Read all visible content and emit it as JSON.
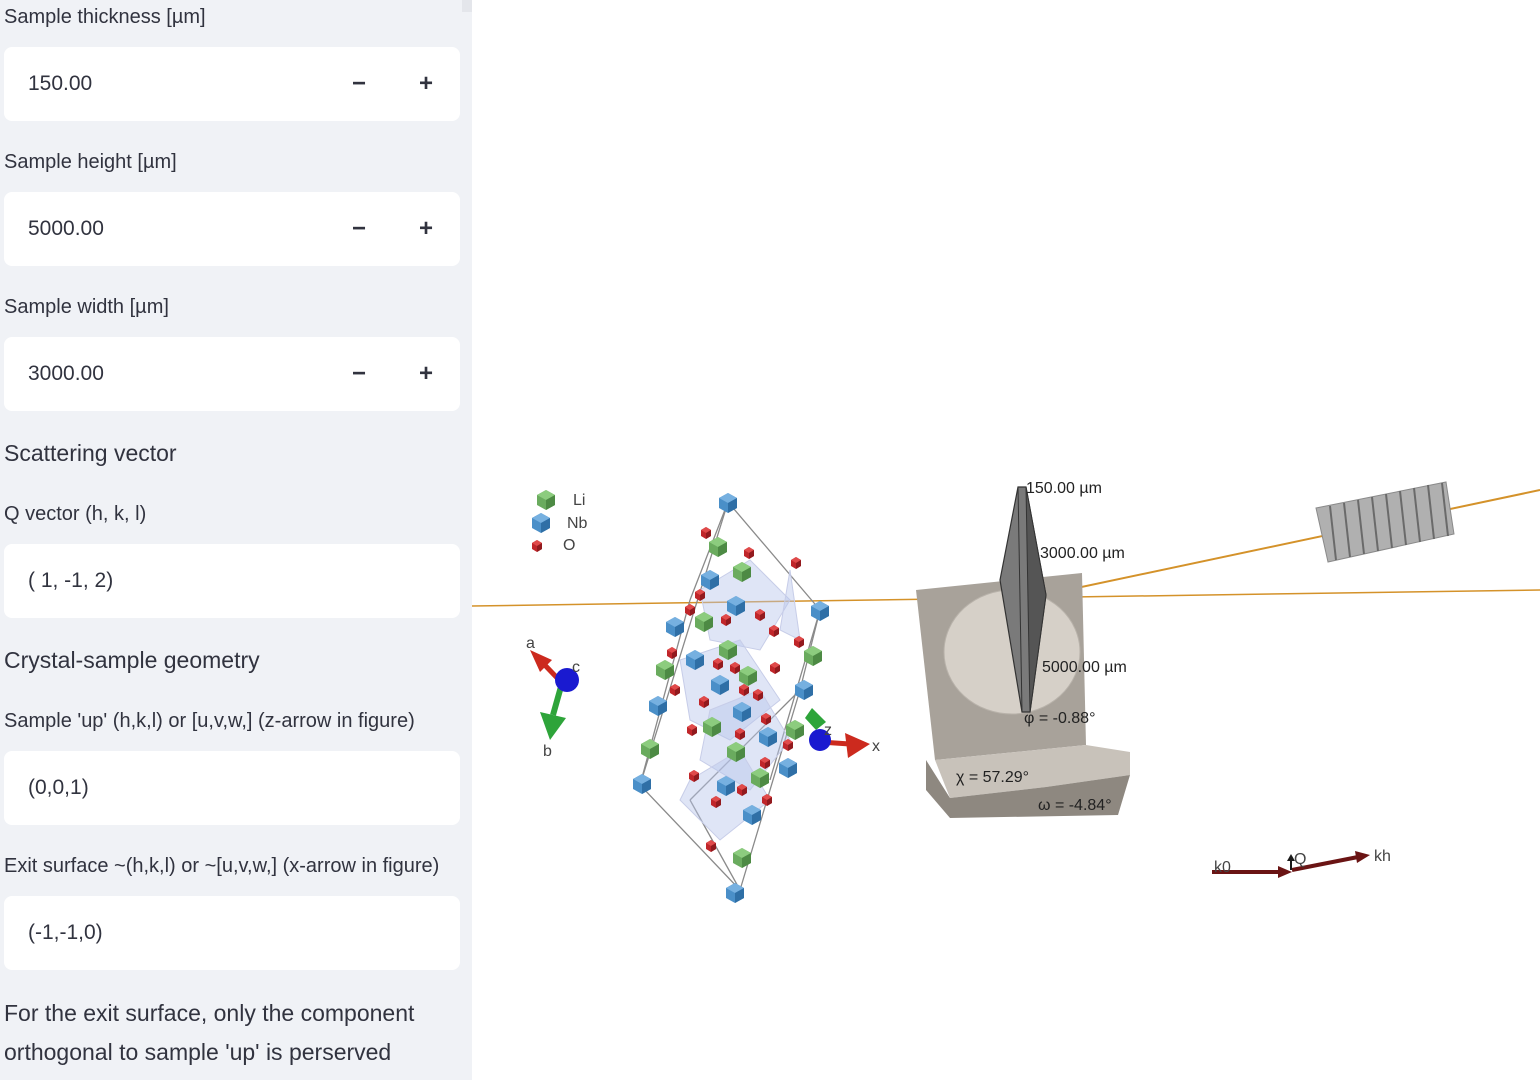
{
  "sidebar": {
    "thickness": {
      "label": "Sample thickness [µm]",
      "value": "150.00"
    },
    "height": {
      "label": "Sample height [µm]",
      "value": "5000.00"
    },
    "width": {
      "label": "Sample width [µm]",
      "value": "3000.00"
    },
    "stepper": {
      "minus": "−",
      "plus": "+"
    },
    "scattering_heading": "Scattering vector",
    "q_vector": {
      "label": "Q vector (h, k, l)",
      "value": "( 1, -1, 2)"
    },
    "geometry_heading": "Crystal-sample geometry",
    "sample_up": {
      "label": "Sample 'up' (h,k,l) or [u,v,w,] (z-arrow in figure)",
      "value": "(0,0,1)"
    },
    "exit_surface": {
      "label": "Exit surface ~(h,k,l) or ~[u,v,w,] (x-arrow in figure)",
      "value": "(-1,-1,0)"
    },
    "note": "For the exit surface, only the component orthogonal to sample 'up' is perserved"
  },
  "scene": {
    "legend": {
      "li": "Li",
      "nb": "Nb",
      "o": "O"
    },
    "colors": {
      "li": "#6aab5e",
      "nb": "#4a8fc8",
      "o": "#c0262a",
      "beam": "#d4922a",
      "holder": "#a8a29a",
      "arrow_red": "#cc2a1e",
      "arrow_green": "#2ea43a",
      "arrow_blue": "#1a1ad0",
      "vector": "#6a1414"
    },
    "axes": {
      "a": "a",
      "b": "b",
      "c": "c",
      "x": "x",
      "z": "z"
    },
    "dims": {
      "thickness": "150.00 µm",
      "width": "3000.00 µm",
      "height": "5000.00 µm"
    },
    "angles": {
      "phi": "φ = -0.88°",
      "chi": "χ = 57.29°",
      "omega": "ω = -4.84°"
    },
    "vectors": {
      "k0": "k0",
      "q": "Q",
      "kh": "kh"
    }
  }
}
